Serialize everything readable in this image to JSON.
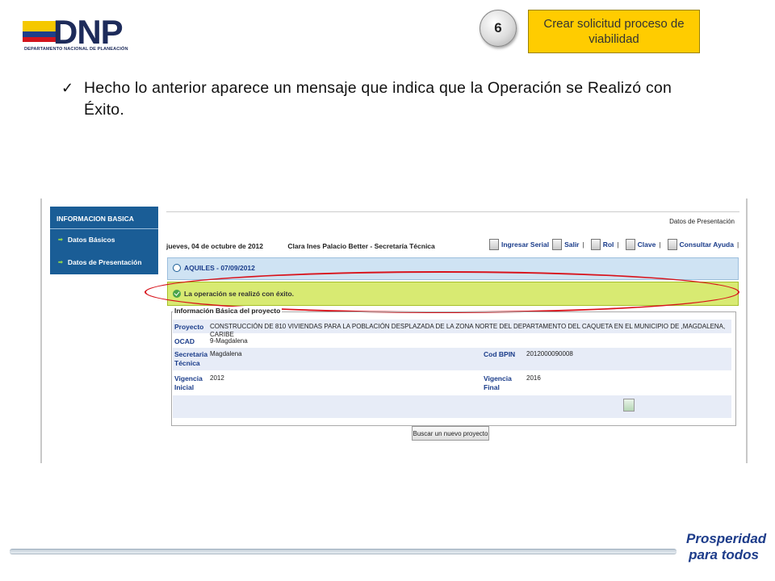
{
  "logo": {
    "name": "DNP",
    "subtitle": "DEPARTAMENTO NACIONAL DE PLANEACIÓN"
  },
  "step": {
    "number": "6",
    "title": "Crear solicitud proceso de viabilidad"
  },
  "instruction": "Hecho lo anterior aparece un mensaje que indica que la Operación se Realizó con Éxito.",
  "screenshot": {
    "sidebar": {
      "header": "INFORMACION BASICA",
      "items": [
        "Datos Básicos",
        "Datos de Presentación"
      ]
    },
    "page_section": "Datos de Presentación",
    "date_line": "jueves, 04 de octubre de 2012",
    "user": "Clara Ines Palacio Better - Secretaría Técnica",
    "toolbar": [
      "Ingresar Serial",
      "Salir",
      "Rol",
      "Clave",
      "Consultar Ayuda"
    ],
    "session_banner": "AQUILES - 07/09/2012",
    "success_message": "La operación se realizó con éxito.",
    "form": {
      "legend": "Información Básica del proyecto",
      "fields": {
        "proyecto_label": "Proyecto",
        "proyecto_value": "CONSTRUCCIÓN DE 810 VIVIENDAS PARA LA POBLACIÓN DESPLAZADA DE LA ZONA NORTE DEL DEPARTAMENTO DEL CAQUETA EN EL MUNICIPIO DE ,MAGDALENA, CARIBE",
        "ocad_label": "OCAD",
        "ocad_value": "9-Magdalena",
        "secretaria_label_1": "Secretaria",
        "secretaria_label_2": "Técnica",
        "secretaria_value": "Magdalena",
        "cod_bpin_label": "Cod BPIN",
        "cod_bpin_value": "2012000090008",
        "vigencia_inicial_label_1": "Vigencia",
        "vigencia_inicial_label_2": "Inicial",
        "vigencia_inicial_value": "2012",
        "vigencia_final_label_1": "Vigencia",
        "vigencia_final_label_2": "Final",
        "vigencia_final_value": "2016"
      }
    },
    "search_button": "Buscar un nuevo proyecto"
  },
  "footer_logo": {
    "line1": "Prosperidad",
    "line2": "para todos"
  },
  "colors": {
    "brand_blue": "#1d2b5a",
    "step_yellow": "#ffcc00",
    "sidebar_blue": "#1a5d96",
    "success_green": "#d8ea72",
    "highlight_red": "#d8141c"
  }
}
